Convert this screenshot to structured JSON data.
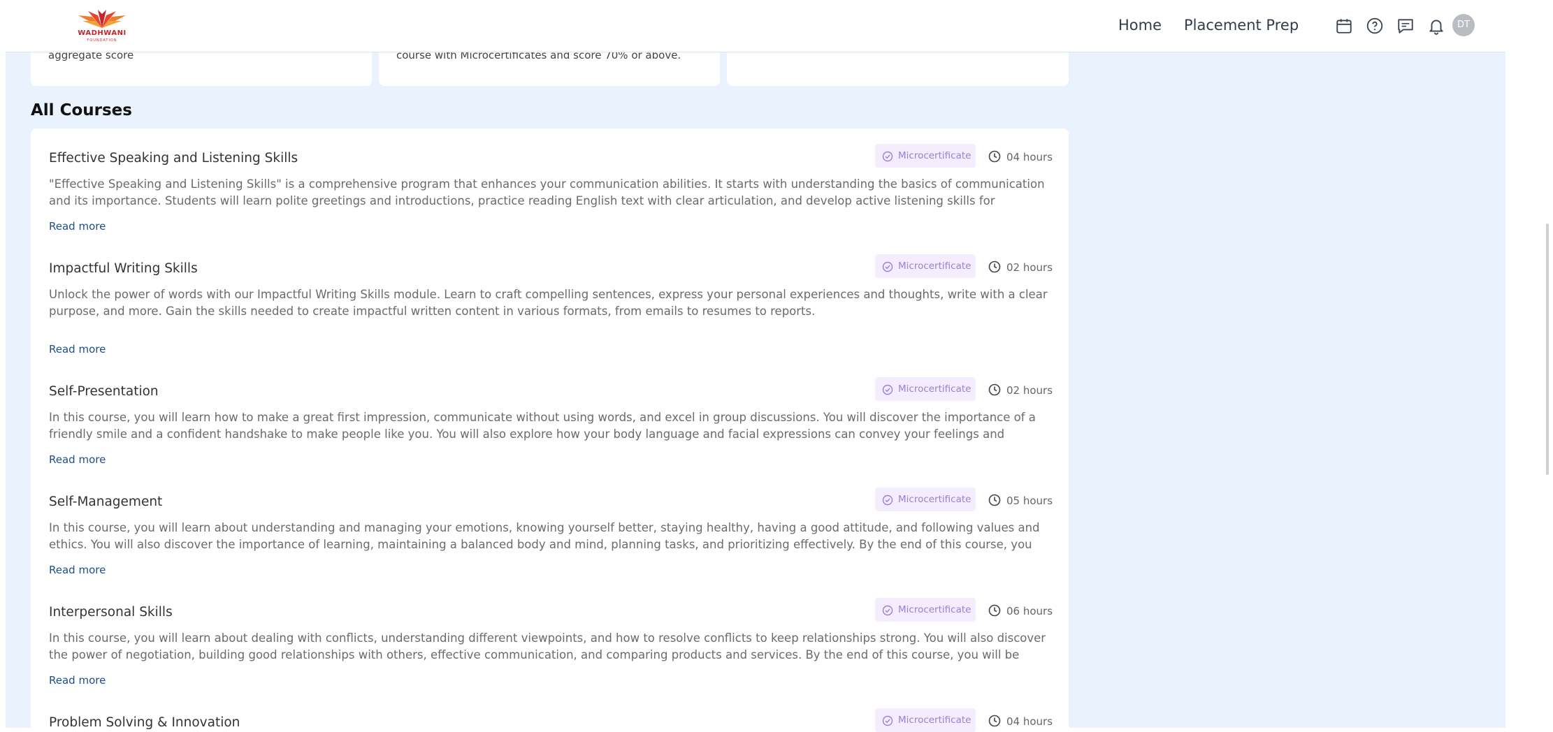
{
  "stray_char": ";",
  "header": {
    "logo_text": "WADHWANI",
    "logo_sub": "FOUNDATION",
    "nav": [
      "Home",
      "Placement Prep"
    ],
    "avatar_initials": "DT"
  },
  "top_cards": [
    {
      "text": "aggregate score"
    },
    {
      "text": "course with Microcertificates and score 70% or above."
    },
    {
      "text": ""
    }
  ],
  "section_title": "All Courses",
  "courses": [
    {
      "title": "Effective Speaking and Listening Skills",
      "badge": "Microcertificate",
      "duration": "04 hours",
      "description": "\"Effective Speaking and Listening Skills\" is a comprehensive program that enhances your communication abilities. It starts with understanding the basics of communication and its importance. Students will learn polite greetings and introductions, practice reading English text with clear articulation, and develop active listening skills for accurate...",
      "read_more": "Read more"
    },
    {
      "title": "Impactful Writing Skills",
      "badge": "Microcertificate",
      "duration": "02 hours",
      "description": "Unlock the power of words with our Impactful Writing Skills module. Learn to craft compelling sentences, express your personal experiences and thoughts, write with a clear purpose, and more. Gain the skills needed to create impactful written content in various formats, from emails to resumes to reports.",
      "read_more": "Read more"
    },
    {
      "title": "Self-Presentation",
      "badge": "Microcertificate",
      "duration": "02 hours",
      "description": "In this course, you will learn how to make a great first impression, communicate without using words, and excel in group discussions. You will discover the importance of a friendly smile and a confident handshake to make people like you. You will also explore how your body language and facial expressions can convey your feelings and thoughts....",
      "read_more": "Read more"
    },
    {
      "title": "Self-Management",
      "badge": "Microcertificate",
      "duration": "05 hours",
      "description": "In this course, you will learn about understanding and managing your emotions, knowing yourself better, staying healthy, having a good attitude, and following values and ethics. You will also discover the importance of learning, maintaining a balanced body and mind, planning tasks, and prioritizing effectively. By the end of this course, you will be...",
      "read_more": "Read more"
    },
    {
      "title": "Interpersonal Skills",
      "badge": "Microcertificate",
      "duration": "06 hours",
      "description": "In this course, you will learn about dealing with conflicts, understanding different viewpoints, and how to resolve conflicts to keep relationships strong. You will also discover the power of negotiation, building good relationships with others, effective communication, and comparing products and services. By the end of this course, you will be better at...",
      "read_more": "Read more"
    },
    {
      "title": "Problem Solving & Innovation",
      "badge": "Microcertificate",
      "duration": "04 hours",
      "description": "",
      "read_more": ""
    }
  ]
}
